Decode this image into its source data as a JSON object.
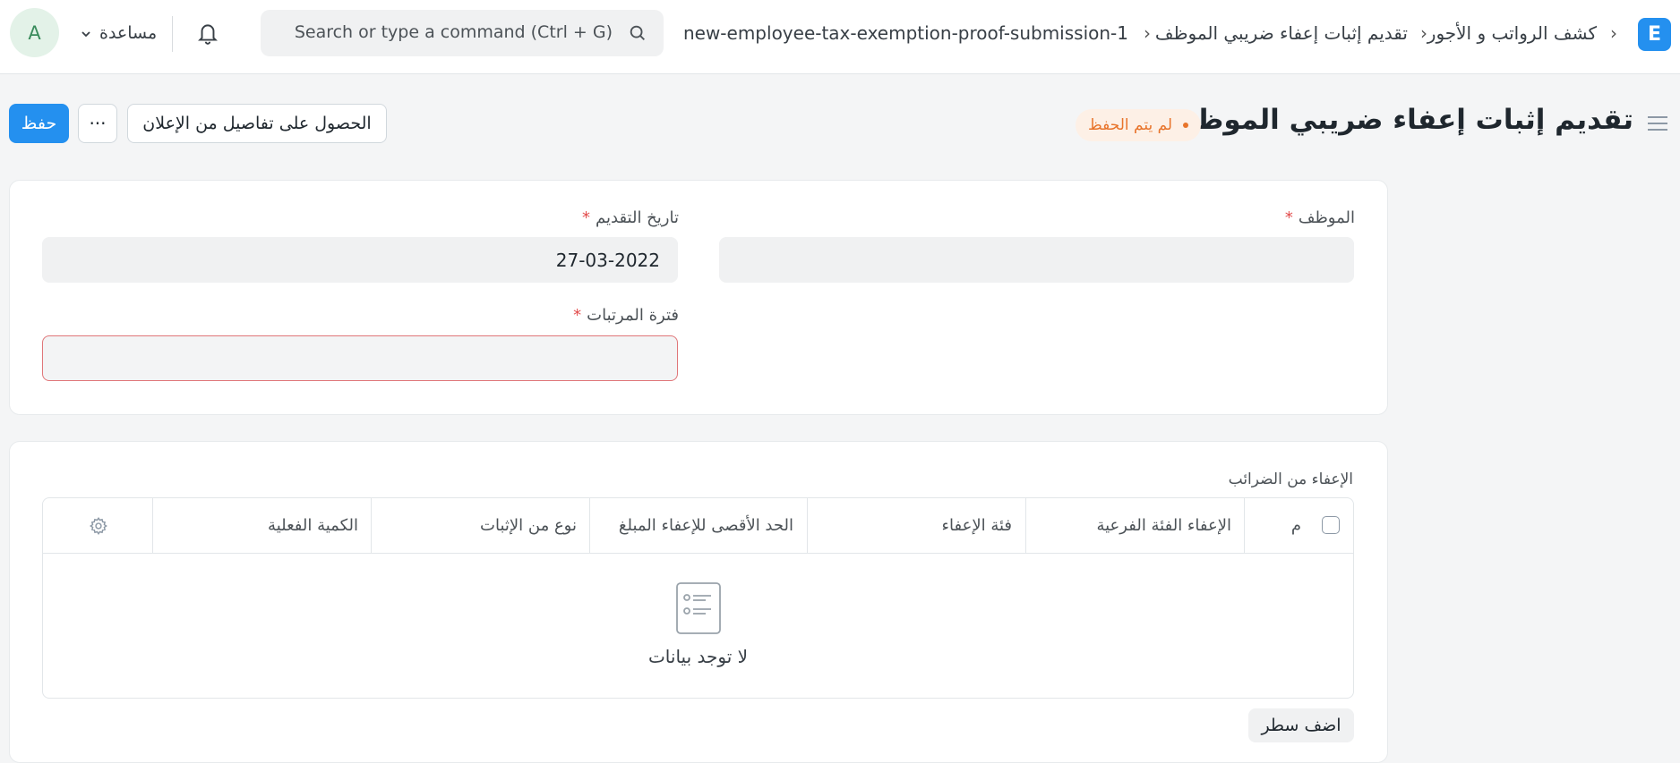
{
  "navbar": {
    "logo_letter": "E",
    "breadcrumbs": [
      "كشف الرواتب و الأجور",
      "تقديم إثبات إعفاء ضريبي الموظف",
      "new-employee-tax-exemption-proof-submission-1"
    ],
    "search_placeholder": "Search or type a command (Ctrl + G)",
    "help_label": "مساعدة",
    "avatar_letter": "A"
  },
  "page": {
    "title": "تقديم إثبات إعفاء ضريبي الموظف جديد",
    "status": "لم يتم الحفظ",
    "get_details_label": "الحصول على تفاصيل من الإعلان",
    "more_label": "···",
    "save_label": "حفظ"
  },
  "form": {
    "employee_label": "الموظف",
    "employee_value": "",
    "submission_date_label": "تاريخ التقديم",
    "submission_date_value": "27-03-2022",
    "payroll_period_label": "فترة المرتبات",
    "payroll_period_value": "",
    "required_mark": "*"
  },
  "table": {
    "section_label": "الإعفاء من الضرائب",
    "columns": {
      "index": "م",
      "sub_category": "الإعفاء الفئة الفرعية",
      "category": "فئة الإعفاء",
      "max_amount": "الحد الأقصى للإعفاء المبلغ",
      "proof_type": "نوع من الإثبات",
      "actual_amount": "الكمية الفعلية"
    },
    "empty_text": "لا توجد بيانات",
    "add_row_label": "اضف سطر"
  },
  "colors": {
    "primary": "#2490ef",
    "status_text": "#e8742b",
    "status_bg": "#fdf0e6",
    "required": "#e24c4c"
  }
}
